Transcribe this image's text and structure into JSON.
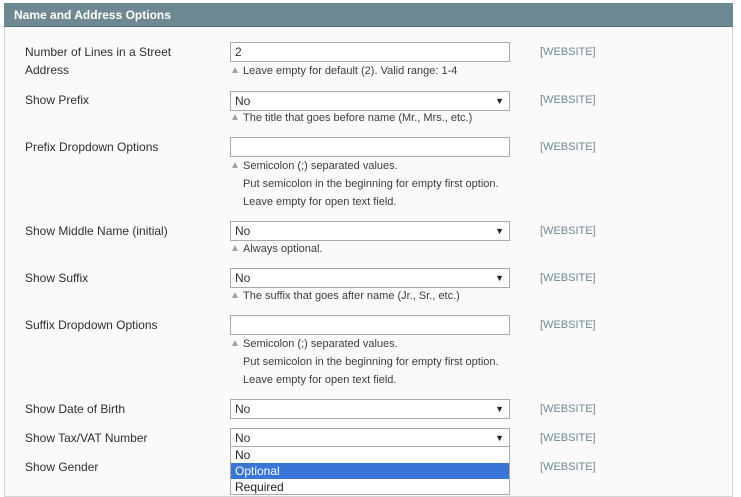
{
  "section": {
    "title": "Name and Address Options"
  },
  "icons": {
    "hint": "triangle-up-icon",
    "select_arrow": "caret-down-icon"
  },
  "colors": {
    "header_bg": "#6f8992",
    "scope_text": "#6f8992",
    "selected_option_bg": "#3875d7"
  },
  "rows": {
    "street_lines": {
      "label": "Number of Lines in a Street Address",
      "value": "2",
      "scope": "[WEBSITE]",
      "hint": [
        "Leave empty for default (2). Valid range: 1-4"
      ]
    },
    "show_prefix": {
      "label": "Show Prefix",
      "value": "No",
      "scope": "[WEBSITE]",
      "hint": [
        "The title that goes before name (Mr., Mrs., etc.)"
      ]
    },
    "prefix_options": {
      "label": "Prefix Dropdown Options",
      "value": "",
      "scope": "[WEBSITE]",
      "hint": [
        "Semicolon (;) separated values.",
        "Put semicolon in the beginning for empty first option.",
        "Leave empty for open text field."
      ]
    },
    "show_middle_name": {
      "label": "Show Middle Name (initial)",
      "value": "No",
      "scope": "[WEBSITE]",
      "hint": [
        "Always optional."
      ]
    },
    "show_suffix": {
      "label": "Show Suffix",
      "value": "No",
      "scope": "[WEBSITE]",
      "hint": [
        "The suffix that goes after name (Jr., Sr., etc.)"
      ]
    },
    "suffix_options": {
      "label": "Suffix Dropdown Options",
      "value": "",
      "scope": "[WEBSITE]",
      "hint": [
        "Semicolon (;) separated values.",
        "Put semicolon in the beginning for empty first option.",
        "Leave empty for open text field."
      ]
    },
    "show_dob": {
      "label": "Show Date of Birth",
      "value": "No",
      "scope": "[WEBSITE]"
    },
    "show_taxvat": {
      "label": "Show Tax/VAT Number",
      "value": "No",
      "scope": "[WEBSITE]"
    },
    "show_gender": {
      "label": "Show Gender",
      "scope": "[WEBSITE]"
    }
  },
  "open_dropdown": {
    "options": [
      "No",
      "Optional",
      "Required"
    ],
    "highlighted": "Optional"
  }
}
